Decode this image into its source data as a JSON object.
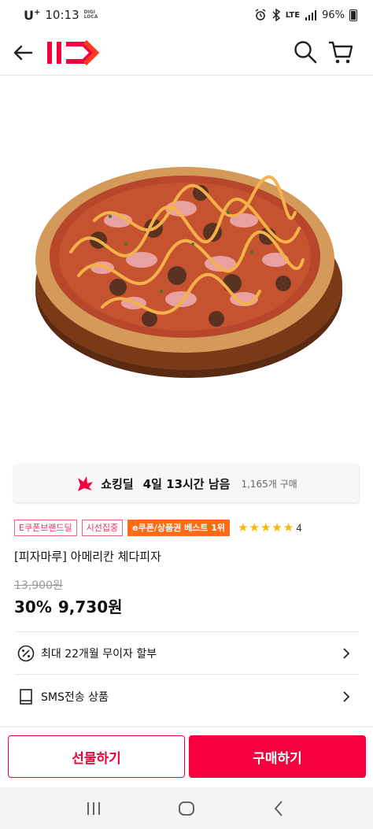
{
  "status_bar": {
    "carrier": "U",
    "carrier_sup": "+",
    "time": "10:13",
    "tiny_label_1": "DIGI",
    "tiny_label_2": "LOCA",
    "network": "LTE",
    "battery": "96%"
  },
  "header": {
    "logo_text": "11"
  },
  "deal": {
    "label": "쇼킹딜",
    "timer": "4일 13시간 남음",
    "purchase_count": "1,165개 구매"
  },
  "badges": [
    "E쿠폰브랜드딜",
    "시선집중"
  ],
  "highlight_badge": "e쿠폰/상품권 베스트 1위",
  "rating": {
    "stars": 5,
    "review_count": "4"
  },
  "product": {
    "title": "[피자마루] 아메리칸 체다피자",
    "original_price": "13,900원",
    "discount": "30%",
    "price": "9,730원"
  },
  "info_rows": [
    {
      "label": "최대 22개월 무이자 할부",
      "icon": "percent-icon"
    },
    {
      "label": "SMS전송 상품",
      "icon": "document-icon"
    }
  ],
  "buttons": {
    "gift": "선물하기",
    "buy": "구매하기"
  },
  "colors": {
    "brand_red": "#f5003f",
    "badge_orange": "#ff6b15",
    "star": "#f5b800"
  }
}
